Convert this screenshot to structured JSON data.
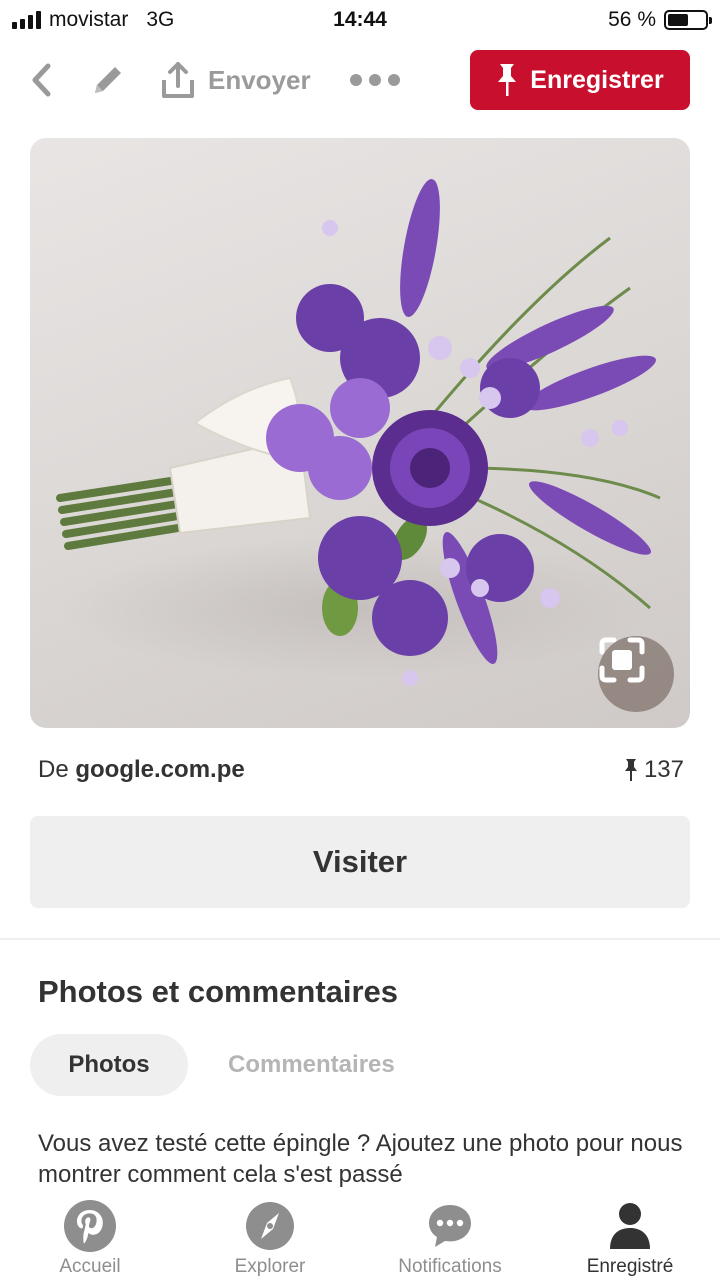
{
  "status_bar": {
    "carrier": "movistar",
    "network": "3G",
    "time": "14:44",
    "battery_percent": "56 %",
    "battery_level": 0.56
  },
  "toolbar": {
    "back_icon": "chevron-left-icon",
    "edit_icon": "pencil-icon",
    "share_label": "Envoyer",
    "share_icon": "share-icon",
    "more_icon": "more-dots-icon",
    "save_label": "Enregistrer",
    "save_icon": "pin-icon"
  },
  "pin": {
    "image_icon": "flower-bouquet-image",
    "zoom_icon": "visual-search-icon",
    "source_prefix": "De",
    "source_domain": "google.com.pe",
    "save_count": "137",
    "visit_label": "Visiter"
  },
  "photos_section": {
    "title": "Photos et commentaires",
    "tabs": [
      {
        "label": "Photos",
        "active": true
      },
      {
        "label": "Commentaires",
        "active": false
      }
    ],
    "prompt": "Vous avez testé cette épingle ? Ajoutez une photo pour nous montrer comment cela s'est passé"
  },
  "bottom_nav": {
    "items": [
      {
        "label": "Accueil",
        "icon": "pinterest-logo-icon",
        "active": false
      },
      {
        "label": "Explorer",
        "icon": "compass-icon",
        "active": false
      },
      {
        "label": "Notifications",
        "icon": "speech-bubble-icon",
        "active": false
      },
      {
        "label": "Enregistré",
        "icon": "person-icon",
        "active": true
      }
    ]
  },
  "colors": {
    "brand_red": "#c8102e",
    "text": "#333333",
    "muted": "#9a9a9a",
    "button_bg": "#efefef"
  }
}
